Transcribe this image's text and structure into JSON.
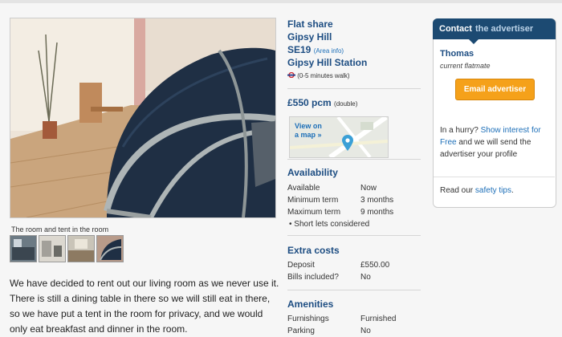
{
  "photo": {
    "caption": "The room and tent in the room"
  },
  "description": "We have decided to rent out our living room as we never use it. There is still a dining table in there so we will still eat in there, so we have put a tent in the room for privacy, and we would only eat breakfast and dinner in the room.",
  "listing": {
    "type": "Flat share",
    "area": "Gipsy Hill",
    "postcode": "SE19",
    "area_info_link": "(Area info)",
    "station": "Gipsy Hill Station",
    "station_distance": "(0-5 minutes walk)",
    "price": "£550 pcm",
    "price_note": "(double)"
  },
  "map": {
    "label_line1": "View on",
    "label_line2": "a map »"
  },
  "availability": {
    "heading": "Availability",
    "rows": [
      {
        "label": "Available",
        "value": "Now"
      },
      {
        "label": "Minimum term",
        "value": "3 months"
      },
      {
        "label": "Maximum term",
        "value": "9 months"
      }
    ],
    "note": "Short lets considered"
  },
  "extra_costs": {
    "heading": "Extra costs",
    "rows": [
      {
        "label": "Deposit",
        "value": "£550.00"
      },
      {
        "label": "Bills included?",
        "value": "No"
      }
    ]
  },
  "amenities": {
    "heading": "Amenities",
    "rows": [
      {
        "label": "Furnishings",
        "value": "Furnished"
      },
      {
        "label": "Parking",
        "value": "No"
      }
    ]
  },
  "contact": {
    "header_contact": "Contact",
    "header_rest": "the advertiser",
    "name": "Thomas",
    "role": "current flatmate",
    "email_button": "Email advertiser",
    "hurry_prefix": "In a hurry?",
    "hurry_link": "Show interest for Free",
    "hurry_suffix": "and we will send the advertiser your profile",
    "safety_prefix": "Read our",
    "safety_link": "safety tips",
    "safety_suffix": "."
  },
  "colors": {
    "accent": "#1c4a72",
    "button": "#f5a11a",
    "link": "#1d6fb8"
  }
}
